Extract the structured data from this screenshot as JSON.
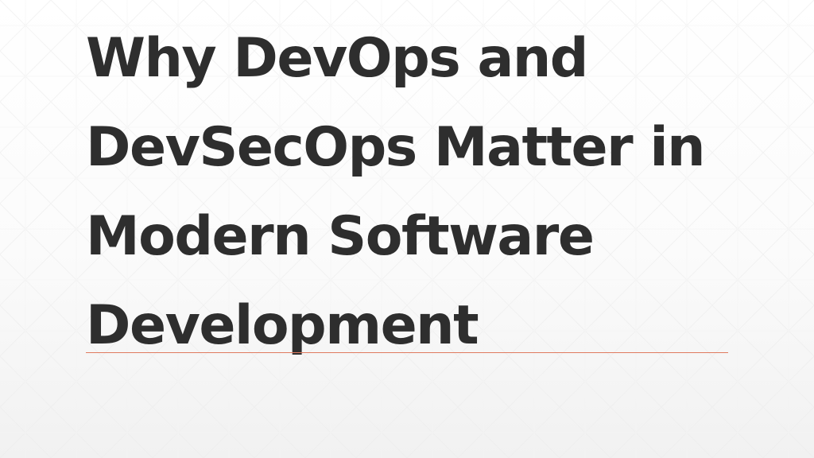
{
  "slide": {
    "title_lines": [
      "Why DevOps and",
      "DevSecOps Matter in",
      "Modern Software",
      "Development"
    ],
    "accent_color": "#e07a5f",
    "text_color": "#2e2e2e"
  }
}
